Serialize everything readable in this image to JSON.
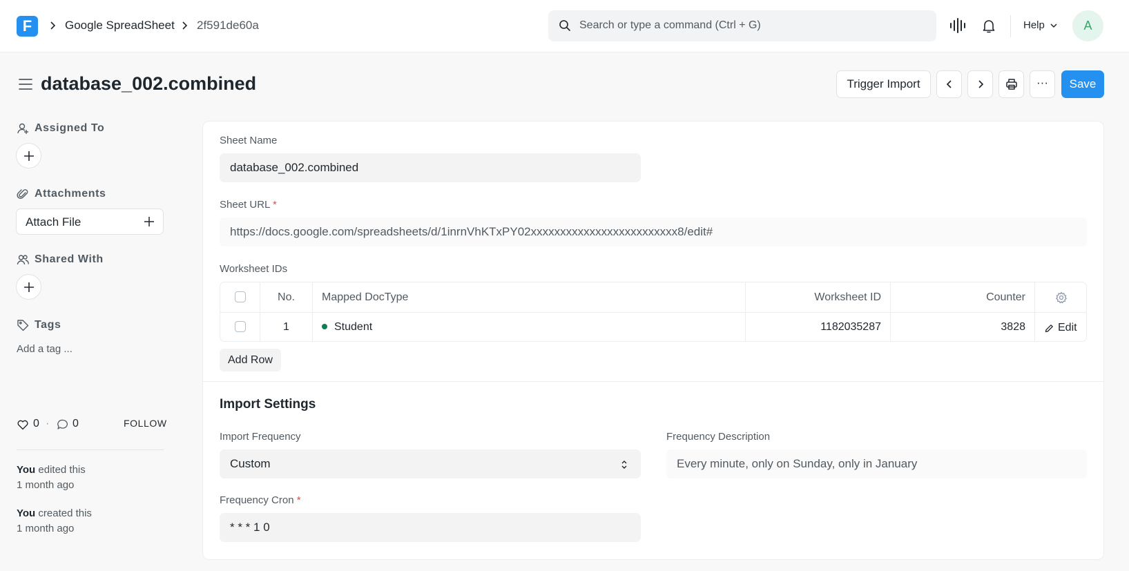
{
  "navbar": {
    "logo_letter": "F",
    "breadcrumbs": [
      "Google SpreadSheet",
      "2f591de60a"
    ],
    "search_placeholder": "Search or type a command (Ctrl + G)",
    "help_label": "Help",
    "avatar_initial": "A"
  },
  "page": {
    "title": "database_002.combined",
    "trigger_import_label": "Trigger Import",
    "more_label": "···",
    "save_label": "Save"
  },
  "sidebar": {
    "assigned_to": "Assigned To",
    "attachments": "Attachments",
    "attach_file": "Attach File",
    "shared_with": "Shared With",
    "tags": "Tags",
    "add_tag": "Add a tag ...",
    "likes_count": "0",
    "comments_count": "0",
    "follow_label": "FOLLOW",
    "activity": [
      {
        "who": "You",
        "action": " edited this",
        "when": "1 month ago"
      },
      {
        "who": "You",
        "action": " created this",
        "when": "1 month ago"
      }
    ]
  },
  "form": {
    "sheet_name_label": "Sheet Name",
    "sheet_name_value": "database_002.combined",
    "sheet_url_label": "Sheet URL",
    "sheet_url_value": "https://docs.google.com/spreadsheets/d/1inrnVhKTxPY02xxxxxxxxxxxxxxxxxxxxxxxxx8/edit#",
    "worksheet_ids_label": "Worksheet IDs",
    "grid_headers": {
      "no": "No.",
      "doctype": "Mapped DocType",
      "worksheet_id": "Worksheet ID",
      "counter": "Counter"
    },
    "grid_rows": [
      {
        "no": "1",
        "doctype": "Student",
        "worksheet_id": "1182035287",
        "counter": "3828",
        "edit": "Edit"
      }
    ],
    "add_row_label": "Add Row",
    "import_settings_title": "Import Settings",
    "import_frequency_label": "Import Frequency",
    "import_frequency_value": "Custom",
    "frequency_description_label": "Frequency Description",
    "frequency_description_value": "Every minute, only on Sunday, only in January",
    "frequency_cron_label": "Frequency Cron",
    "frequency_cron_value": "* * * 1 0",
    "required_mark": "*"
  },
  "colors": {
    "primary": "#2490ef",
    "status_dot": "#137b50",
    "required": "#e24c4c"
  }
}
